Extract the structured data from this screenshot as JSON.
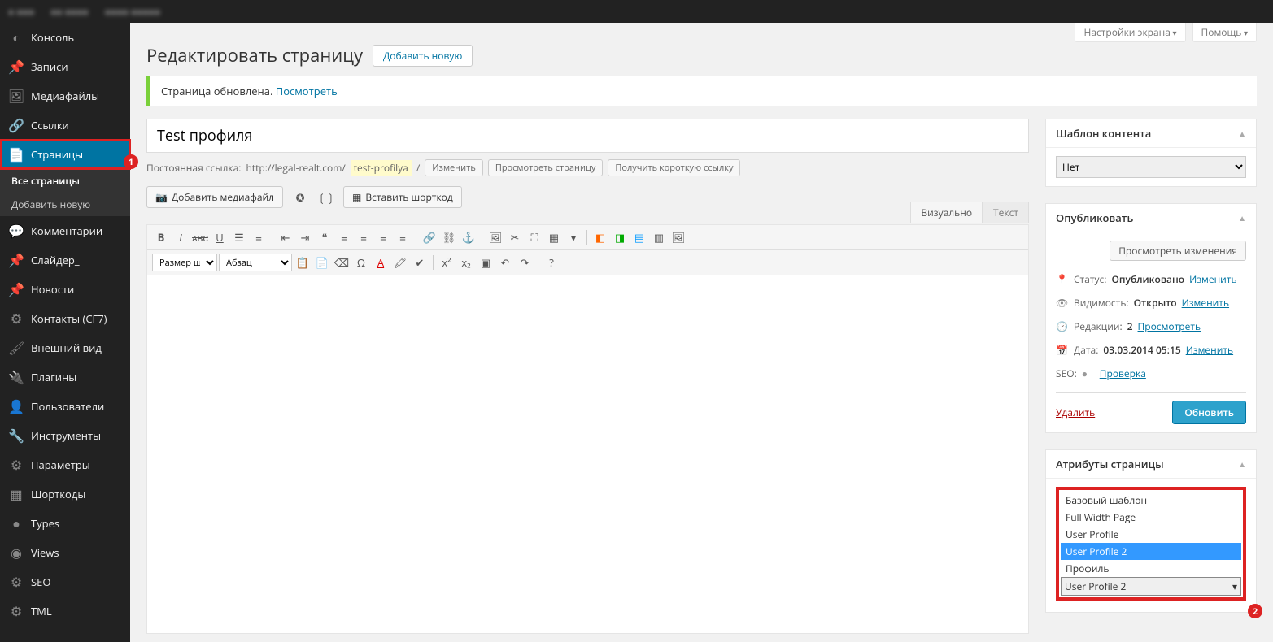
{
  "screen_meta": {
    "options": "Настройки экрана",
    "help": "Помощь"
  },
  "page": {
    "title": "Редактировать страницу",
    "add_new": "Добавить новую"
  },
  "notice": {
    "text": "Страница обновлена. ",
    "link": "Посмотреть"
  },
  "post": {
    "title": "Test профиля"
  },
  "permalink": {
    "label": "Постоянная ссылка:",
    "base": "http://legal-realt.com/",
    "slug": "test-profilya",
    "slash": "/",
    "edit": "Изменить",
    "view": "Просмотреть страницу",
    "shortlink": "Получить короткую ссылку"
  },
  "media": {
    "add": "Добавить медиафайл",
    "shortcode": "Вставить шорткод"
  },
  "editor_tabs": {
    "visual": "Визуально",
    "text": "Текст"
  },
  "toolbar": {
    "font_size": "Размер шри",
    "format": "Абзац"
  },
  "sidebar": [
    {
      "icon": "◐",
      "label": "Консоль"
    },
    {
      "icon": "📌",
      "label": "Записи"
    },
    {
      "icon": "🖼",
      "label": "Медиафайлы"
    },
    {
      "icon": "🔗",
      "label": "Ссылки"
    },
    {
      "icon": "📄",
      "label": "Страницы",
      "active": true,
      "highlight": true
    },
    {
      "icon": "💬",
      "label": "Комментарии"
    },
    {
      "icon": "📌",
      "label": "Слайдер_"
    },
    {
      "icon": "📌",
      "label": "Новости"
    },
    {
      "icon": "⚙",
      "label": "Контакты (CF7)"
    },
    {
      "icon": "🖌",
      "label": "Внешний вид"
    },
    {
      "icon": "🔌",
      "label": "Плагины"
    },
    {
      "icon": "👤",
      "label": "Пользователи"
    },
    {
      "icon": "🔧",
      "label": "Инструменты"
    },
    {
      "icon": "⚙",
      "label": "Параметры"
    },
    {
      "icon": "▦",
      "label": "Шорткоды"
    },
    {
      "icon": "●",
      "label": "Types"
    },
    {
      "icon": "◉",
      "label": "Views"
    },
    {
      "icon": "⚙",
      "label": "SEO"
    },
    {
      "icon": "⚙",
      "label": "TML"
    }
  ],
  "sidebar_sub": {
    "all": "Все страницы",
    "add": "Добавить новую"
  },
  "badge1": "1",
  "box_template": {
    "title": "Шаблон контента",
    "value": "Нет"
  },
  "box_publish": {
    "title": "Опубликовать",
    "preview": "Просмотреть изменения",
    "status_label": "Статус:",
    "status_value": "Опубликовано",
    "status_edit": "Изменить",
    "vis_label": "Видимость:",
    "vis_value": "Открыто",
    "vis_edit": "Изменить",
    "rev_label": "Редакции:",
    "rev_value": "2",
    "rev_link": "Просмотреть",
    "date_label": "Дата:",
    "date_value": "03.03.2014 05:15",
    "date_edit": "Изменить",
    "seo_label": "SEO:",
    "seo_link": "Проверка",
    "delete": "Удалить",
    "update": "Обновить"
  },
  "box_attrs": {
    "title": "Атрибуты страницы",
    "options": [
      "Базовый шаблон",
      "Full Width Page",
      "User Profile",
      "User Profile 2",
      "Профиль"
    ],
    "selected": "User Profile 2"
  },
  "badge2": "2"
}
